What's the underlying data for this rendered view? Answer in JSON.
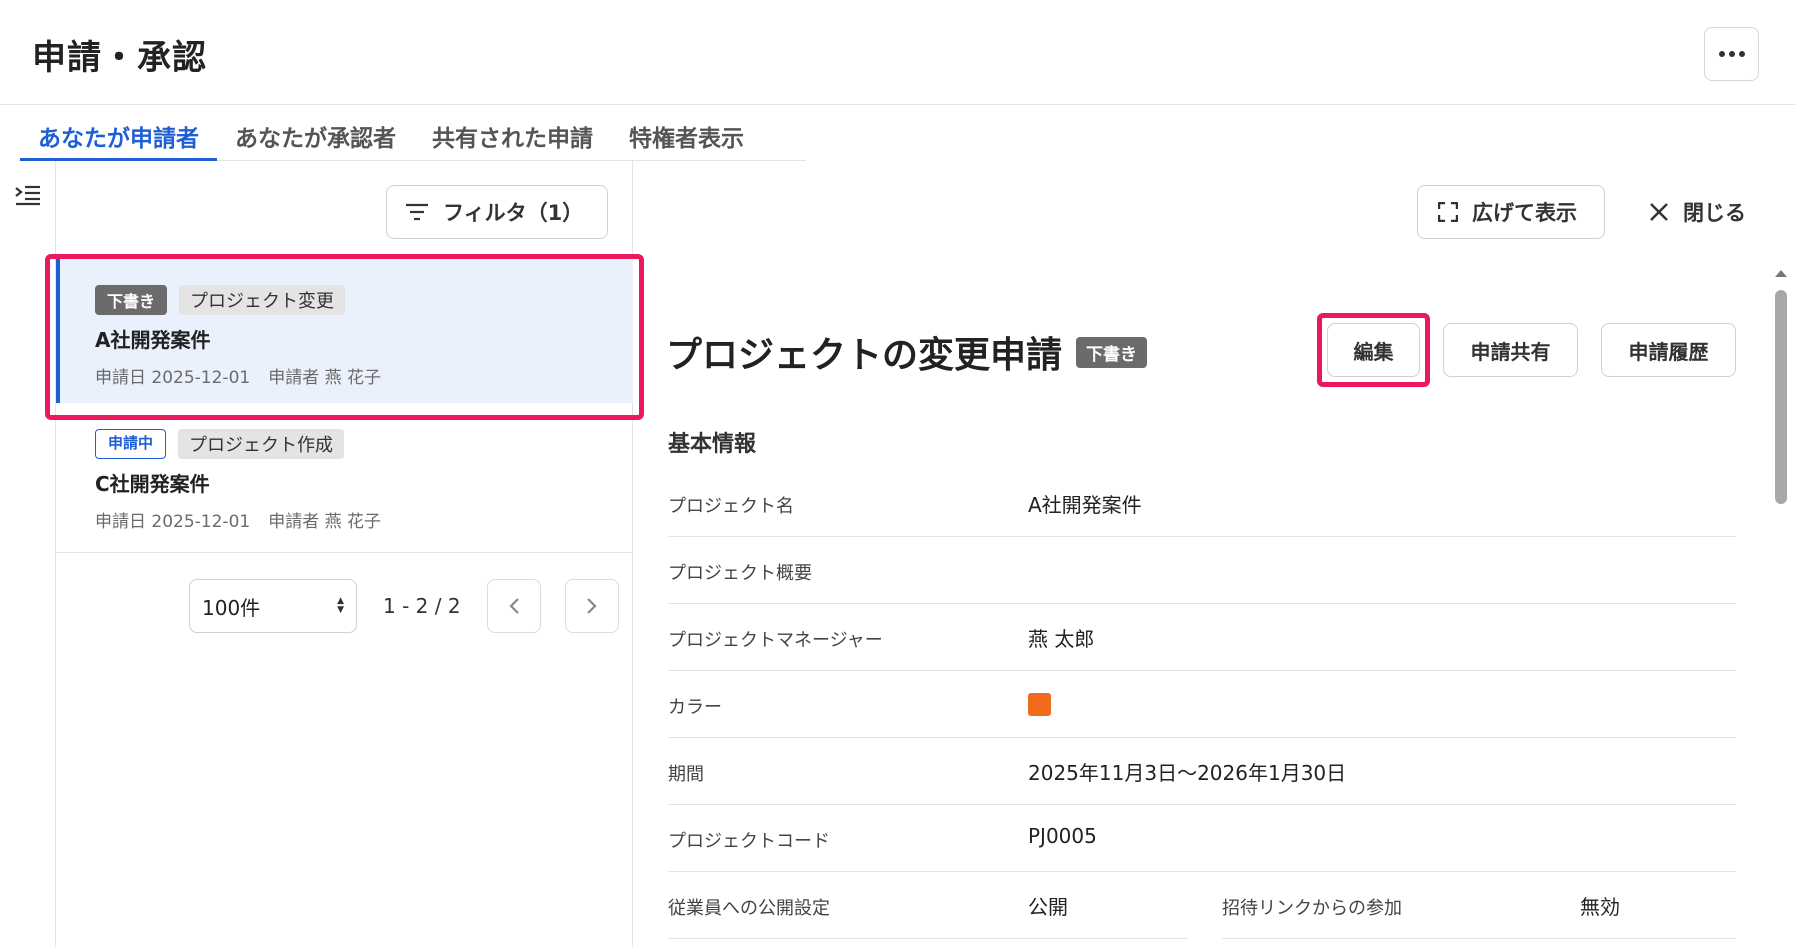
{
  "app": {
    "title": "申請・承認"
  },
  "tabs": [
    {
      "label": "あなたが申請者",
      "active": true
    },
    {
      "label": "あなたが承認者",
      "active": false
    },
    {
      "label": "共有された申請",
      "active": false
    },
    {
      "label": "特権者表示",
      "active": false
    }
  ],
  "list": {
    "filter_label": "フィルタ（1）",
    "items": [
      {
        "status": "下書き",
        "type": "プロジェクト変更",
        "title": "A社開発案件",
        "date": "申請日 2025-12-01",
        "applicant": "申請者 燕 花子",
        "selected": true
      },
      {
        "status": "申請中",
        "type": "プロジェクト作成",
        "title": "C社開発案件",
        "date": "申請日 2025-12-01",
        "applicant": "申請者 燕 花子",
        "selected": false
      }
    ],
    "page_size": "100件",
    "page_range": "1 - 2 / 2"
  },
  "detail": {
    "expand_label": "広げて表示",
    "close_label": "閉じる",
    "title": "プロジェクトの変更申請",
    "status": "下書き",
    "actions": {
      "edit": "編集",
      "share": "申請共有",
      "history": "申請履歴"
    },
    "section_title": "基本情報",
    "fields": [
      {
        "label": "プロジェクト名",
        "value": "A社開発案件"
      },
      {
        "label": "プロジェクト概要",
        "value": ""
      },
      {
        "label": "プロジェクトマネージャー",
        "value": "燕 太郎"
      },
      {
        "label": "カラー",
        "value": "",
        "color": "#f26a1b"
      },
      {
        "label": "期間",
        "value": "2025年11月3日～2026年1月30日"
      },
      {
        "label": "プロジェクトコード",
        "value": "PJ0005"
      }
    ],
    "publish": {
      "label": "従業員への公開設定",
      "value": "公開",
      "label2": "招待リンクからの参加",
      "value2": "無効"
    }
  },
  "colors": {
    "accent": "#1e5fd6",
    "highlight": "#e8195c",
    "draft_badge": "#6b6b6b"
  },
  "icons": {
    "more": "more-horizontal-icon",
    "menu": "menu-collapse-icon",
    "filter": "filter-icon",
    "expand": "expand-icon",
    "close": "close-icon"
  }
}
